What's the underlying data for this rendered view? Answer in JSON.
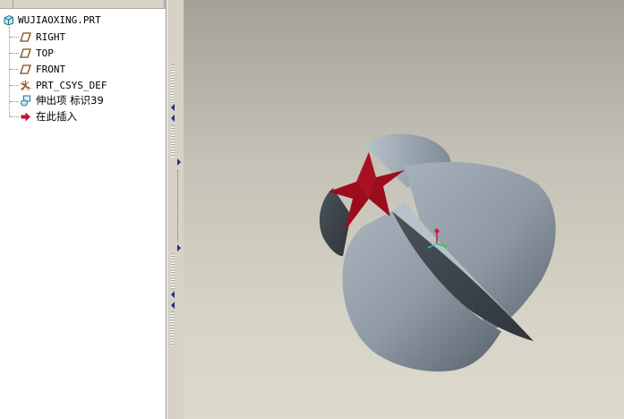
{
  "model_tree": {
    "root": {
      "label": "WUJIAOXING.PRT",
      "icon": "part-icon"
    },
    "items": [
      {
        "label": "RIGHT",
        "icon": "datum-plane-icon"
      },
      {
        "label": "TOP",
        "icon": "datum-plane-icon"
      },
      {
        "label": "FRONT",
        "icon": "datum-plane-icon"
      },
      {
        "label": "PRT_CSYS_DEF",
        "icon": "coordinate-system-icon"
      },
      {
        "label": "伸出项 标识39",
        "icon": "protrusion-icon"
      },
      {
        "label": "在此插入",
        "icon": "insert-here-arrow-icon"
      }
    ]
  },
  "colors": {
    "model_body": "#9aa4ad",
    "star": "#9c0c1c",
    "insert_arrow": "#c8102e",
    "splitter_arrows": "#1f2e8a"
  }
}
